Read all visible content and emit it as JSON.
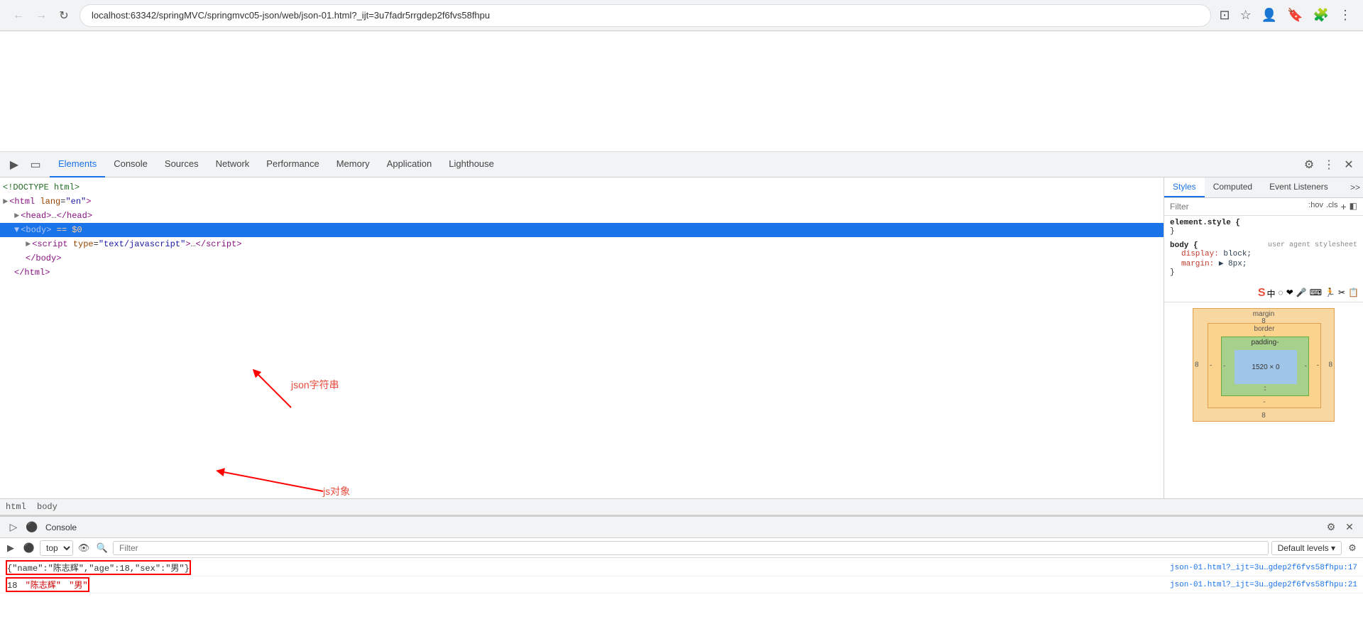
{
  "browser": {
    "url": "localhost:63342/springMVC/springmvc05-json/web/json-01.html?_ijt=3u7fadr5rrgdep2f6fvs58fhpu",
    "back_disabled": true,
    "forward_disabled": true
  },
  "devtools": {
    "tabs": [
      {
        "label": "Elements",
        "active": true
      },
      {
        "label": "Console",
        "active": false
      },
      {
        "label": "Sources",
        "active": false
      },
      {
        "label": "Network",
        "active": false
      },
      {
        "label": "Performance",
        "active": false
      },
      {
        "label": "Memory",
        "active": false
      },
      {
        "label": "Application",
        "active": false
      },
      {
        "label": "Lighthouse",
        "active": false
      }
    ],
    "styles_tabs": [
      {
        "label": "Styles",
        "active": true
      },
      {
        "label": "Computed",
        "active": false
      },
      {
        "label": "Event Listeners",
        "active": false
      }
    ],
    "styles_filter_placeholder": "Filter",
    "styles_filter_hov": ":hov",
    "styles_filter_cls": ".cls",
    "css_rules": [
      {
        "selector": "element.style {",
        "closing": "}",
        "properties": []
      },
      {
        "selector": "body {",
        "comment": "user agent stylesheet",
        "closing": "}",
        "properties": [
          {
            "name": "display:",
            "value": "block;"
          },
          {
            "name": "margin:",
            "value": "▶ 8px;"
          }
        ]
      }
    ],
    "box_model": {
      "margin_label": "margin",
      "margin_value": "8",
      "border_label": "border",
      "border_dash": "-",
      "padding_label": "padding-",
      "content_size": "1520 × 0",
      "content_dash": "-",
      "bottom_value": "8",
      "left_value": "8",
      "right_value": "8",
      "minus_1": "-",
      "minus_2": "-"
    }
  },
  "dom": {
    "lines": [
      {
        "indent": 0,
        "text": "<!DOCTYPE html>",
        "type": "comment"
      },
      {
        "indent": 0,
        "html": "<span class='expand-arrow'>▶</span><span class='tag'>&lt;html</span> <span class='attr-name'>lang</span>=<span class='attr-value'>\"en\"</span><span class='tag'>&gt;</span>",
        "selected": false
      },
      {
        "indent": 1,
        "html": "<span class='expand-arrow'>▶</span><span class='tag'>&lt;head&gt;</span><span style='color:#555'>…</span><span class='tag'>&lt;/head&gt;</span>",
        "selected": false
      },
      {
        "indent": 1,
        "html": "<span style='color:#888'>▼</span> <span class='tag'>&lt;body&gt;</span> <span class='special'>== $0</span>",
        "selected": true
      },
      {
        "indent": 2,
        "html": "<span class='expand-arrow'>▶</span><span class='tag'>&lt;script</span> <span class='attr-name'>type</span>=<span class='attr-value'>\"text/javascript\"</span><span class='tag'>&gt;</span><span style='color:#555'>…</span><span class='tag'>&lt;/script&gt;</span>",
        "selected": false
      },
      {
        "indent": 2,
        "html": "<span class='tag'>&lt;/body&gt;</span>",
        "selected": false
      },
      {
        "indent": 1,
        "html": "<span class='tag'>&lt;/html&gt;</span>",
        "selected": false
      }
    ]
  },
  "breadcrumb": {
    "items": [
      "html",
      "body"
    ]
  },
  "console": {
    "title": "Console",
    "top_options": [
      "top"
    ],
    "filter_placeholder": "Filter",
    "default_levels": "Default levels ▾",
    "lines": [
      {
        "content": "{\"name\":\"陈志辉\",\"age\":18,\"sex\":\"男\"}",
        "source": "json-01.html?_ijt=3u…gdep2f6fvs58fhpu:17",
        "type": "json"
      },
      {
        "content": "18  \"陈志辉\"  \"男\"",
        "source": "json-01.html?_ijt=3u…gdep2f6fvs58fhpu:21",
        "type": "jsobj"
      }
    ]
  },
  "annotations": {
    "json_label": "json字符串",
    "js_label": "js对象"
  },
  "ime_icons": [
    "S",
    "中",
    "◌̈",
    "❤",
    "🎤",
    "⌨",
    "🏃",
    "✂",
    "📋"
  ]
}
